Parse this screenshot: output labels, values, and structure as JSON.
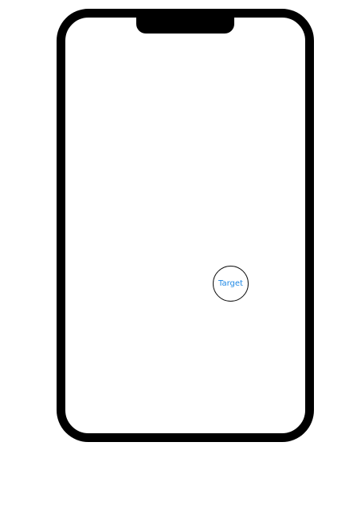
{
  "device": {
    "frame_color": "#000000",
    "screen_color": "#ffffff"
  },
  "target": {
    "label": "Target",
    "label_color": "#1e88e5",
    "border_color": "#111111"
  }
}
